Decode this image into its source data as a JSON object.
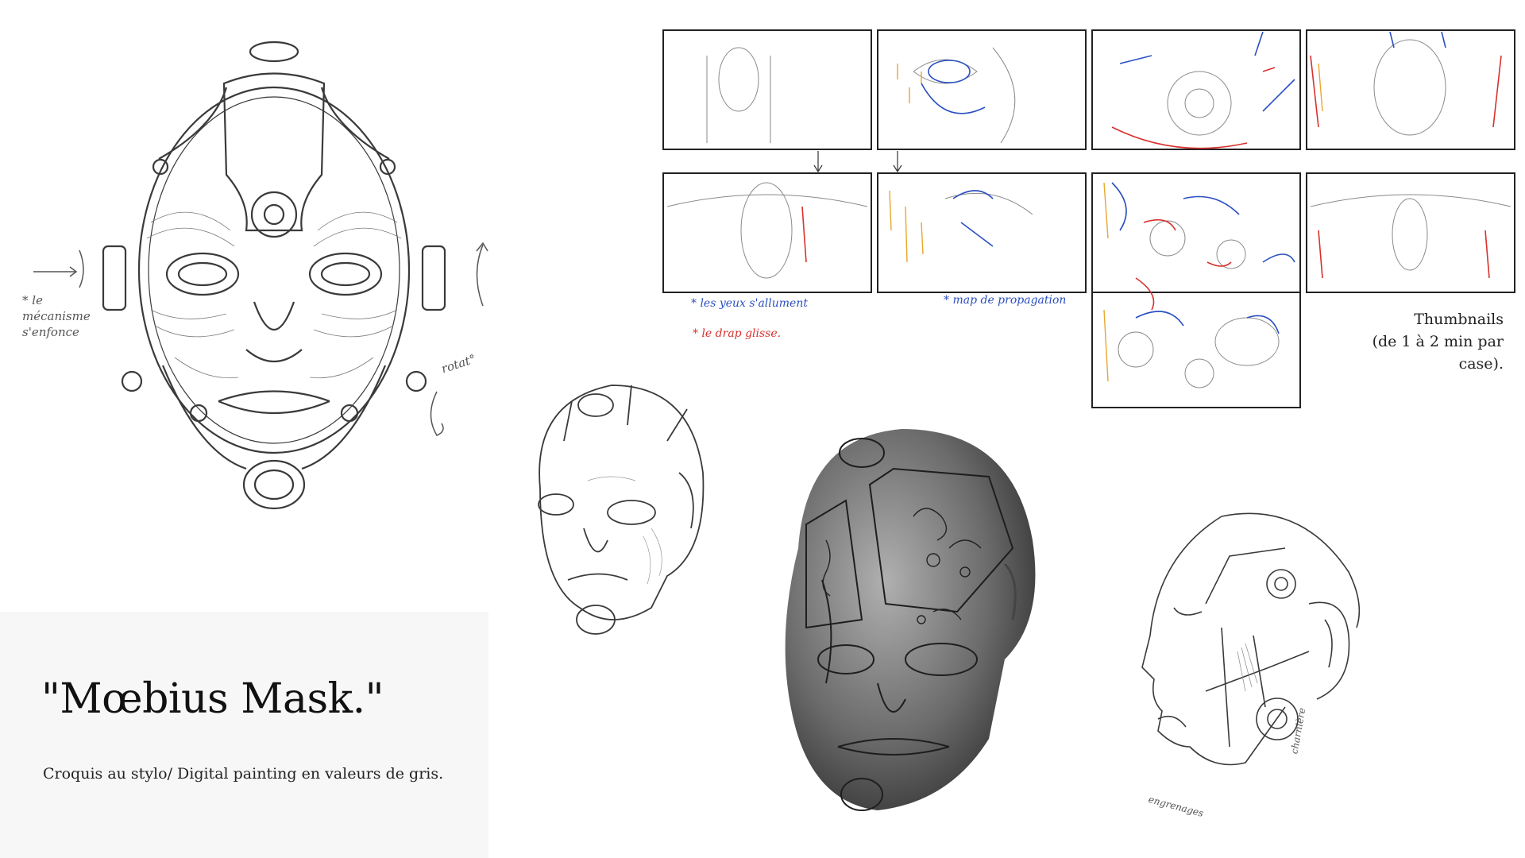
{
  "title": "\"Mœbius Mask.\"",
  "subtitle": "Croquis au stylo/ Digital painting en valeurs de gris.",
  "thumbnails_caption": [
    "Thumbnails",
    "(de 1 à 2 min par",
    "case)."
  ],
  "storyboard_notes": {
    "eyes": "* les yeux s'allument",
    "drape": "* le drap glisse.",
    "map": "* map de propagation"
  },
  "sketch_notes": {
    "left": [
      "* le",
      "mécanisme",
      "s'enfonce"
    ],
    "right": "rotat°",
    "profile_bottom": "engrenages",
    "profile_side": "charnière"
  },
  "colors": {
    "background": "#ffffff",
    "panel": "#f7f7f7",
    "pencil": "#3a3a3a",
    "note_blue": "#2a4fc0",
    "note_red": "#d8312e",
    "note_orange": "#e8a630"
  }
}
